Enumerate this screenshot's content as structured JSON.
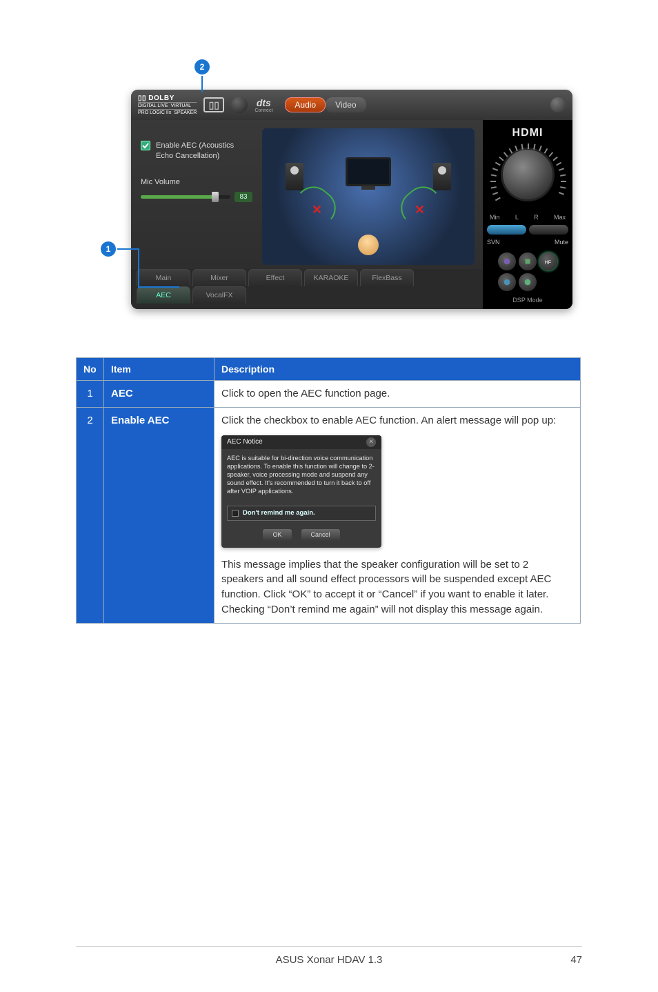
{
  "callouts": {
    "one": "1",
    "two": "2"
  },
  "app": {
    "dolby": {
      "brand": "DOLBY",
      "line1_a": "DIGITAL LIVE",
      "line1_b": "VIRTUAL",
      "line2_a": "PRO LOGIC IIx",
      "line2_b": "SPEAKER"
    },
    "dts": {
      "brand": "dts",
      "sub": "Connect"
    },
    "headerTabs": {
      "audio": "Audio",
      "video": "Video"
    },
    "leftPanel": {
      "enable_aec": "Enable AEC (Acoustics Echo Cancellation)",
      "mic_volume": "Mic Volume",
      "mic_value": "83"
    },
    "right": {
      "hdmi": "HDMI",
      "min": "Min",
      "max": "Max",
      "l": "L",
      "r": "R",
      "svn": "SVN",
      "mute": "Mute",
      "dsp": "DSP Mode"
    },
    "tabs": {
      "main": "Main",
      "mixer": "Mixer",
      "effect": "Effect",
      "karaoke": "KARAOKE",
      "flexbass": "FlexBass",
      "aec": "AEC",
      "vocalfx": "VocalFX"
    }
  },
  "table": {
    "head": {
      "no": "No",
      "item": "Item",
      "desc": "Description"
    },
    "row1": {
      "no": "1",
      "item": "AEC",
      "desc": "Click to open the AEC function page."
    },
    "row2": {
      "no": "2",
      "item": "Enable AEC",
      "p1": "Click the checkbox to enable AEC function. An alert message will pop up:",
      "dialog": {
        "title": "AEC Notice",
        "body": "AEC is suitable for bi-direction voice communication applications. To enable this function will change to 2-speaker, voice processing mode and suspend any sound effect. It's recommended to turn it back to off after VOIP applications.",
        "remind": "Don't remind me again.",
        "ok": "OK",
        "cancel": "Cancel"
      },
      "p2": "This message implies that the speaker configuration will be set to 2 speakers and all sound effect processors will be suspended except AEC function. Click “OK” to accept it or “Cancel” if you want to enable it later. Checking “Don’t remind me again” will not display this message again."
    }
  },
  "footer": {
    "product": "ASUS Xonar HDAV 1.3",
    "page": "47"
  }
}
